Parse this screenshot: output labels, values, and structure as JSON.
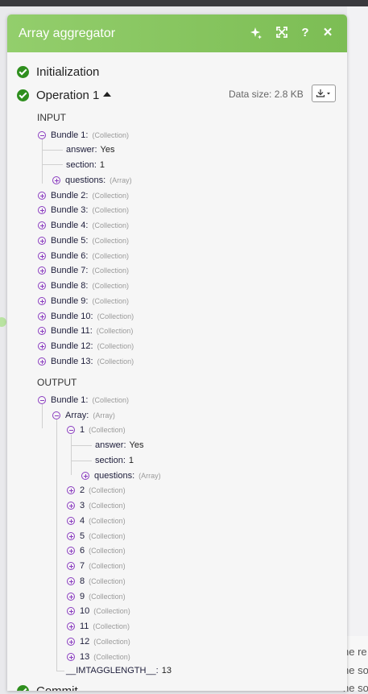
{
  "module": {
    "title": "Array aggregator",
    "help_label": "?",
    "close_label": "×"
  },
  "steps": {
    "initialization": "Initialization",
    "operation": "Operation 1",
    "next_step": "Commit"
  },
  "data_size": "Data size: 2.8 KB",
  "input": {
    "label": "INPUT",
    "bundle1": {
      "key": "Bundle 1:",
      "type": "(Collection)",
      "answer_key": "answer:",
      "answer_val": "Yes",
      "section_key": "section:",
      "section_val": "1",
      "questions_key": "questions:",
      "questions_type": "(Array)"
    },
    "bundles": [
      {
        "key": "Bundle 2:",
        "type": "(Collection)"
      },
      {
        "key": "Bundle 3:",
        "type": "(Collection)"
      },
      {
        "key": "Bundle 4:",
        "type": "(Collection)"
      },
      {
        "key": "Bundle 5:",
        "type": "(Collection)"
      },
      {
        "key": "Bundle 6:",
        "type": "(Collection)"
      },
      {
        "key": "Bundle 7:",
        "type": "(Collection)"
      },
      {
        "key": "Bundle 8:",
        "type": "(Collection)"
      },
      {
        "key": "Bundle 9:",
        "type": "(Collection)"
      },
      {
        "key": "Bundle 10:",
        "type": "(Collection)"
      },
      {
        "key": "Bundle 11:",
        "type": "(Collection)"
      },
      {
        "key": "Bundle 12:",
        "type": "(Collection)"
      },
      {
        "key": "Bundle 13:",
        "type": "(Collection)"
      }
    ]
  },
  "output": {
    "label": "OUTPUT",
    "bundle1": {
      "key": "Bundle 1:",
      "type": "(Collection)"
    },
    "array": {
      "key": "Array:",
      "type": "(Array)"
    },
    "item1": {
      "key": "1",
      "type": "(Collection)",
      "answer_key": "answer:",
      "answer_val": "Yes",
      "section_key": "section:",
      "section_val": "1",
      "questions_key": "questions:",
      "questions_type": "(Array)"
    },
    "items": [
      {
        "key": "2",
        "type": "(Collection)"
      },
      {
        "key": "3",
        "type": "(Collection)"
      },
      {
        "key": "4",
        "type": "(Collection)"
      },
      {
        "key": "5",
        "type": "(Collection)"
      },
      {
        "key": "6",
        "type": "(Collection)"
      },
      {
        "key": "7",
        "type": "(Collection)"
      },
      {
        "key": "8",
        "type": "(Collection)"
      },
      {
        "key": "9",
        "type": "(Collection)"
      },
      {
        "key": "10",
        "type": "(Collection)"
      },
      {
        "key": "11",
        "type": "(Collection)"
      },
      {
        "key": "12",
        "type": "(Collection)"
      },
      {
        "key": "13",
        "type": "(Collection)"
      }
    ],
    "length_key": "__IMTAGGLENGTH__:",
    "length_val": "13"
  },
  "background_text": [
    "he re",
    "he so",
    "he so"
  ],
  "colors": {
    "header": "#8cc763",
    "success": "#2f8f1e",
    "toggle": "#8a3cc0"
  }
}
